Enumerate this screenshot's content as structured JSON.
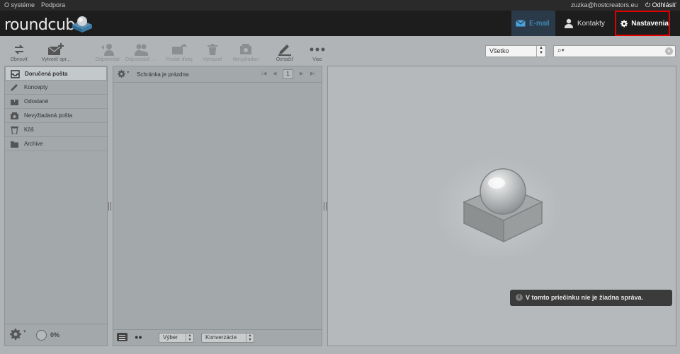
{
  "topbar": {
    "about": "O systéme",
    "support": "Podpora",
    "user": "zuzka@hostcreators.eu",
    "logout": "Odhlásiť"
  },
  "header": {
    "logo_text": "roundcube"
  },
  "nav": {
    "email": "E-mail",
    "contacts": "Kontakty",
    "settings": "Nastavenia"
  },
  "toolbar": {
    "refresh": "Obnoviť",
    "compose": "Vytvoriť spr...",
    "reply": "Odpovedať",
    "reply_all": "Odpovedať ...",
    "forward": "Poslať ďalej",
    "delete": "Vymazať",
    "junk": "Nevyžiadan",
    "mark": "Označiť",
    "more": "Viac"
  },
  "filter": {
    "selected": "Všetko"
  },
  "search": {
    "placeholder": ""
  },
  "folders": [
    {
      "label": "Doručená pošta",
      "icon": "inbox-icon"
    },
    {
      "label": "Koncepty",
      "icon": "pencil-icon"
    },
    {
      "label": "Odoslané",
      "icon": "sent-icon"
    },
    {
      "label": "Nevyžiadaná pošta",
      "icon": "junk-icon"
    },
    {
      "label": "Kôš",
      "icon": "trash-icon"
    },
    {
      "label": "Archive",
      "icon": "folder-icon"
    }
  ],
  "folder_footer": {
    "quota": "0%"
  },
  "list": {
    "status": "Schránka je prázdna",
    "page": "1"
  },
  "list_footer": {
    "select_label": "Výber",
    "threads_label": "Konverzácie"
  },
  "notice": {
    "icon_glyph": "i",
    "text": "V tomto priečinku nie je žiadna správa."
  },
  "colors": {
    "accent": "#4aa3df",
    "highlight": "#e00000",
    "header_bg": "#1d1d1d"
  }
}
